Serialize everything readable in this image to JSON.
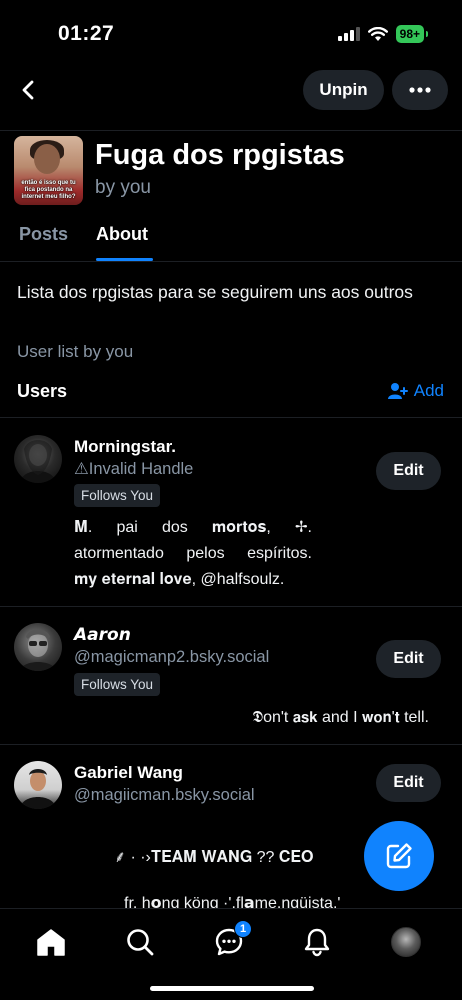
{
  "status": {
    "time": "01:27",
    "battery": "98+"
  },
  "nav": {
    "unpin": "Unpin"
  },
  "list": {
    "title": "Fuga dos rpgistas",
    "by": "by you",
    "avatar_caption": "então é isso que tu fica postando na internet meu filho?"
  },
  "tabs": [
    {
      "label": "Posts"
    },
    {
      "label": "About"
    }
  ],
  "about": {
    "description": "Lista dos rpgistas para se seguirem uns aos outros",
    "user_list_by": "User list by you",
    "users_label": "Users",
    "add_label": "Add"
  },
  "users": [
    {
      "name": "Morningstar.",
      "handle": "⚠Invalid Handle",
      "follows_you": "Follows You",
      "edit": "Edit",
      "bio": [
        "𝐌. pai dos 𝐦𝐨𝐫𝐭𝐨𝐬, ✢.",
        "atormentado pelos espíritos.",
        "𝐦𝐲 𝐞𝐭𝐞𝐫𝐧𝐚𝐥 𝐥𝐨𝐯𝐞, @halfsoulz."
      ]
    },
    {
      "name": "𝘼𝙖𝙧𝙤𝙣",
      "handle": "@magicmanp2.bsky.social",
      "follows_you": "Follows You",
      "edit": "Edit",
      "bio": [
        "𝕯on't 𝗮𝘀𝗸 and I 𝘄𝗼𝗻'𝘁 tell."
      ]
    },
    {
      "name": "Gabriel Wang",
      "handle": "@magiicman.bsky.social",
      "edit": "Edit",
      "bio": [
        "⸙ · ·›𝐓𝐄𝐀𝐌 𝐖𝐀𝐍𝐆 ?? 𝐂𝐄𝐎",
        "fr. h𝗼ng köng ·'.fl𝗮m̲e.ngüista.'"
      ]
    }
  ],
  "bottom_nav": {
    "chat_badge": "1"
  },
  "colors": {
    "accent": "#1083fe",
    "muted": "#8996a5",
    "surface": "#1e2329",
    "background": "#000000"
  }
}
